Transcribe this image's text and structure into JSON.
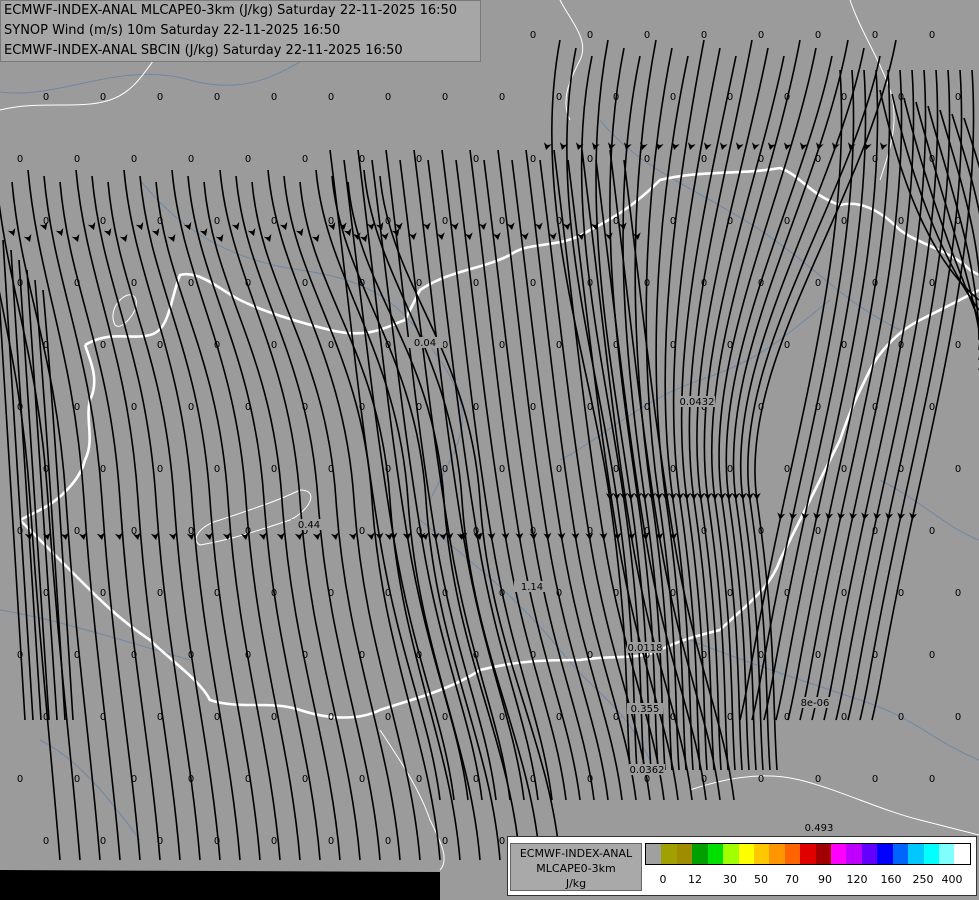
{
  "titles": [
    "ECMWF-INDEX-ANAL MLCAPE0-3km (J/kg) Saturday 22-11-2025 16:50",
    "SYNOP Wind (m/s) 10m Saturday 22-11-2025 16:50",
    "ECMWF-INDEX-ANAL SBCIN (J/kg) Saturday 22-11-2025 16:50"
  ],
  "legend": {
    "line1": "ECMWF-INDEX-ANAL",
    "line2": "MLCAPE0-3km",
    "line3": "J/kg",
    "colors": [
      "#a0a0a0",
      "#a0a000",
      "#a08c00",
      "#00a000",
      "#00e000",
      "#a0ff00",
      "#ffff00",
      "#ffc800",
      "#ff9600",
      "#ff6400",
      "#e00000",
      "#a00000",
      "#ff00ff",
      "#c000ff",
      "#6400ff",
      "#0000ff",
      "#0064ff",
      "#00c8ff",
      "#00ffff",
      "#80ffff",
      "#ffffff"
    ],
    "ticks": [
      "0",
      "12",
      "30",
      "50",
      "70",
      "90",
      "120",
      "160",
      "250",
      "400"
    ]
  },
  "station_values": [
    {
      "label": "0"
    },
    {
      "label": "0.04"
    },
    {
      "label": "0.0432"
    },
    {
      "label": "0.44"
    },
    {
      "label": "1.14"
    },
    {
      "label": "0.0118"
    },
    {
      "label": "0.355"
    },
    {
      "label": "0.0362"
    },
    {
      "label": "8e-06"
    },
    {
      "label": "0.493"
    }
  ]
}
